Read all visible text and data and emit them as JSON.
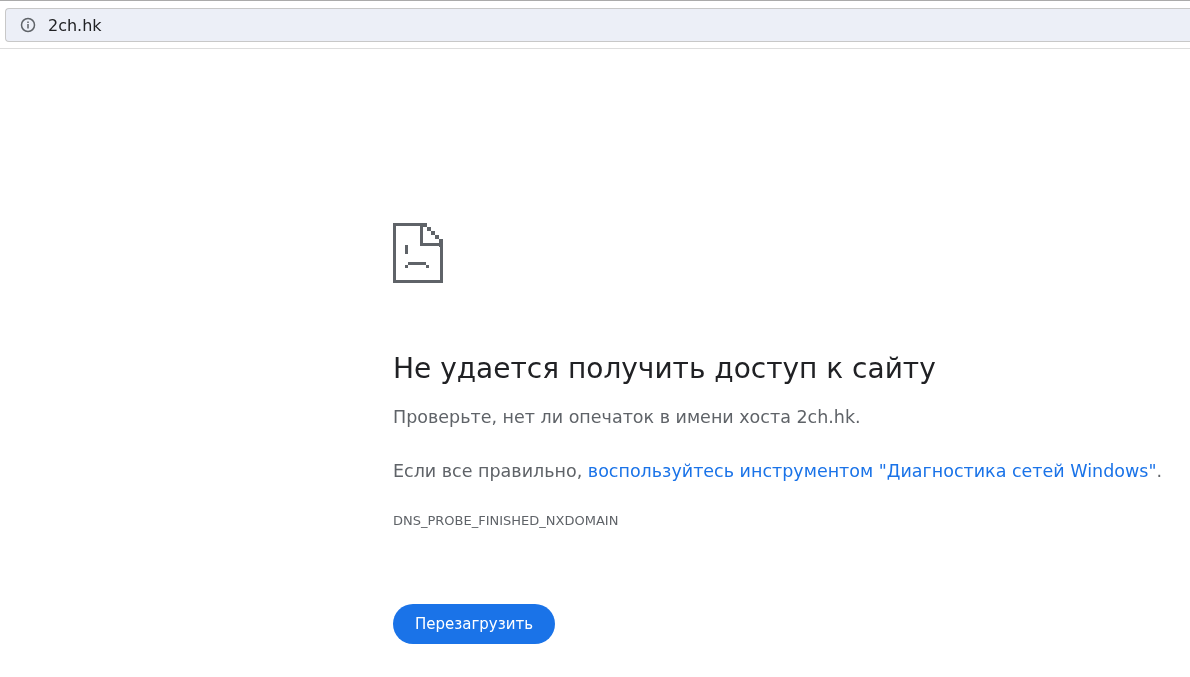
{
  "address_bar": {
    "url": "2ch.hk"
  },
  "error": {
    "title": "Не удается получить доступ к сайту",
    "paragraphs": [
      {
        "text": "Проверьте, нет ли опечаток в имени хоста 2ch.hk."
      },
      {
        "text": "Если все правильно, ",
        "link": "воспользуйтесь инструментом \"Диагностика сетей Windows\"",
        "after": "."
      }
    ],
    "code": "DNS_PROBE_FINISHED_NXDOMAIN",
    "button": "Перезагрузить"
  }
}
